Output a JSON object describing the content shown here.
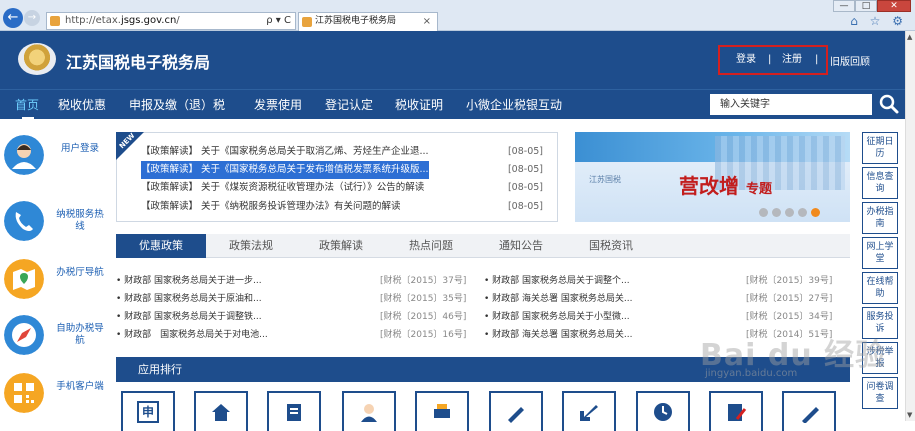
{
  "browser": {
    "url_prefix": "http://etax.",
    "url_domain": "jsgs.gov.cn",
    "url_suffix": "/",
    "addr_tools": "ρ ▾ C",
    "tab_title": "江苏国税电子税务局",
    "tab_close": "×",
    "win_min": "—",
    "win_max": "□",
    "win_close": "✕",
    "toolbar_icons": "⌂ ☆ ⚙"
  },
  "header": {
    "title": "江苏国税电子税务局",
    "login": "登录",
    "sep1": "|",
    "register": "注册",
    "sep2": "|",
    "old_version": "旧版回顾"
  },
  "nav": {
    "items": [
      "首页",
      "税收优惠",
      "申报及缴（退）税",
      "发票使用",
      "登记认定",
      "税收证明",
      "小微企业税银互动"
    ],
    "search_placeholder": "输入关键字"
  },
  "left_col": {
    "items": [
      {
        "label": "用户登录",
        "icon": "user-icon"
      },
      {
        "label": "纳税服务热线",
        "icon": "phone-icon"
      },
      {
        "label": "办税厅导航",
        "icon": "map-icon"
      },
      {
        "label": "自助办税导航",
        "icon": "compass-icon"
      },
      {
        "label": "手机客户端",
        "icon": "qr-icon"
      }
    ]
  },
  "news": {
    "tag": "NEW",
    "rows": [
      {
        "text": "【政策解读】 关于《国家税务总局关于取消乙烯、芳烃生产企业退...",
        "date": "[08-05]"
      },
      {
        "text": "【政策解读】 关于《国家税务总局关于发布增值税发票系统升级版...",
        "date": "[08-05]"
      },
      {
        "text": "【政策解读】 关于《煤炭资源税征收管理办法（试行）》公告的解读",
        "date": "[08-05]"
      },
      {
        "text": "【政策解读】 关于《纳税服务投诉管理办法》有关问题的解读",
        "date": "[08-05]"
      }
    ]
  },
  "banner": {
    "small_text": "江苏国税",
    "title": "营改增",
    "title_suffix": "专题"
  },
  "tabs": [
    "优惠政策",
    "政策法规",
    "政策解读",
    "热点问题",
    "通知公告",
    "国税资讯"
  ],
  "policy": {
    "left": [
      {
        "text": "• 财政部 国家税务总局关于进一步...",
        "code": "[财税〔2015〕37号]"
      },
      {
        "text": "• 财政部 国家税务总局关于原油和...",
        "code": "[财税〔2015〕35号]"
      },
      {
        "text": "• 财政部 国家税务总局关于调整铁...",
        "code": "[财税〔2015〕46号]"
      },
      {
        "text": "• 财政部　国家税务总局关于对电池...",
        "code": "[财税〔2015〕16号]"
      }
    ],
    "right": [
      {
        "text": "• 财政部 国家税务总局关于调整个...",
        "code": "[财税〔2015〕39号]"
      },
      {
        "text": "• 财政部 海关总署 国家税务总局关...",
        "code": "[财税〔2015〕27号]"
      },
      {
        "text": "• 财政部 国家税务总局关于小型微...",
        "code": "[财税〔2015〕34号]"
      },
      {
        "text": "• 财政部 海关总署 国家税务总局关...",
        "code": "[财税〔2014〕51号]"
      }
    ]
  },
  "apps": {
    "title": "应用排行",
    "tiles": [
      "申",
      "home",
      "doc",
      "person",
      "printer",
      "pen",
      "arrow",
      "clock",
      "form",
      "edit"
    ]
  },
  "right_col": {
    "items": [
      "征期日历",
      "信息查询",
      "办税指南",
      "网上学堂",
      "在线帮助",
      "服务投诉",
      "涉税举报",
      "问卷调查"
    ]
  },
  "watermark": {
    "text": "Bai du 经验",
    "sub": "jingyan.baidu.com"
  }
}
